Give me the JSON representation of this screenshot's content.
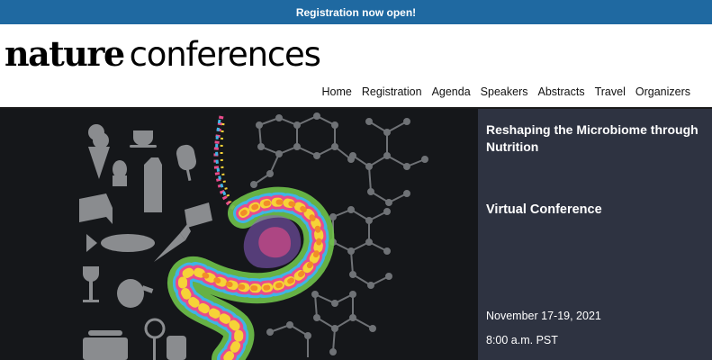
{
  "announcement": "Registration now open!",
  "brand": {
    "bold": "nature",
    "light": "conferences"
  },
  "nav": [
    "Home",
    "Registration",
    "Agenda",
    "Speakers",
    "Abstracts",
    "Travel",
    "Organizers"
  ],
  "event": {
    "title": "Reshaping the Microbiome through Nutrition",
    "format": "Virtual Conference",
    "dates": "November 17-19, 2021",
    "time": "8:00 a.m. PST"
  },
  "colors": {
    "top_bar": "#1f69a1",
    "hero_bg": "#15171a",
    "panel_bg": "#2e3341"
  },
  "hero_icons": [
    "ice-cream-icon",
    "coffee-cup-icon",
    "egg-icon",
    "milk-carton-icon",
    "popsicle-icon",
    "cake-icon",
    "cheese-icon",
    "fish-icon",
    "carrot-icon",
    "wine-glass-icon",
    "ham-icon",
    "pot-icon",
    "lollipop-icon",
    "stomach-illustration",
    "molecule-icon"
  ]
}
